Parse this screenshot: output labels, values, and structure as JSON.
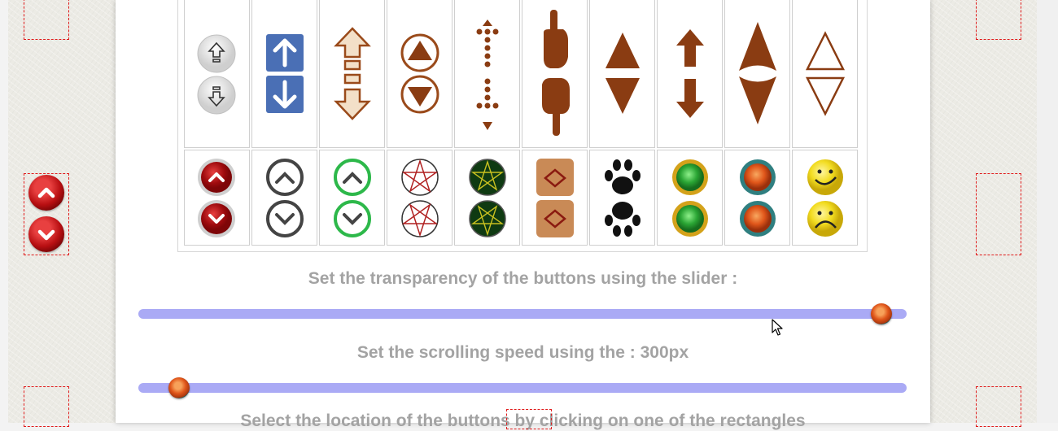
{
  "labels": {
    "transparency_caption": "Set the transparency of the buttons using the slider :",
    "speed_caption": "Set the scrolling speed using the : 300px",
    "location_caption_partial": "Select the location of the buttons by clicking on one of the rectangles"
  },
  "sliders": {
    "transparency_percent": 98,
    "speed_percent": 4
  },
  "button_styles": {
    "row1": [
      "grey-outline-arrows",
      "blue-square-arrows",
      "wood-outline-arrows",
      "wood-circle-triangles",
      "wood-dotted-arrows",
      "wood-pointing-hands",
      "wood-triangles",
      "wood-bold-arrows",
      "wood-tall-spikes",
      "outline-triangles"
    ],
    "row2": [
      "red-chevron-buttons",
      "dark-chevron-circles",
      "green-chevron-circles",
      "pentagram-stars",
      "green-pentagram-discs",
      "wood-tile-diamonds",
      "paw-prints",
      "green-gold-orbs",
      "orange-teal-orbs",
      "smiley-faces"
    ]
  },
  "colors": {
    "slider_track": "#aaaaf5",
    "caption_text": "#a3a3a3",
    "dashed_border": "#e01b1b"
  }
}
